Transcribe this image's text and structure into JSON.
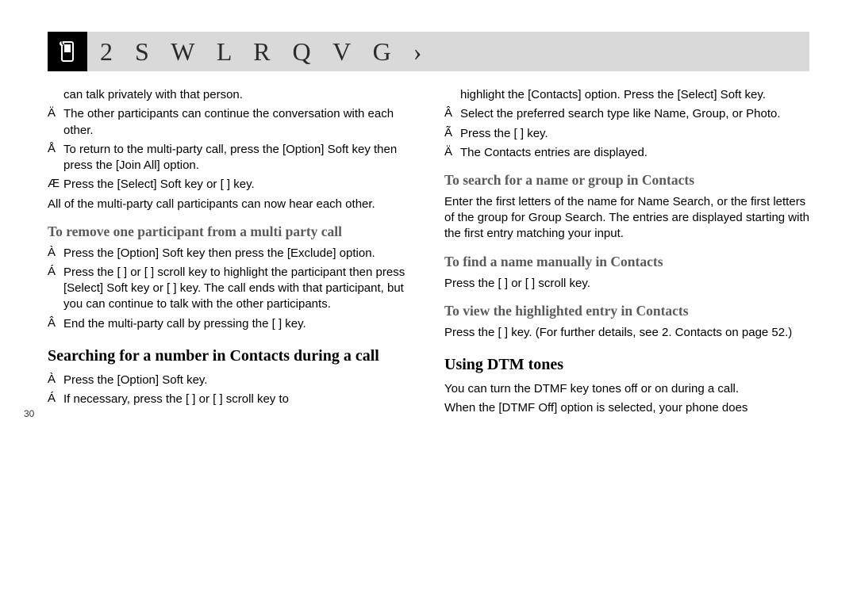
{
  "header": {
    "title": "2 S W L R Q V  G ›"
  },
  "page_number": "30",
  "left_col": {
    "p1": "can talk privately with that person.",
    "b1": "The other participants can continue the conversation with each other.",
    "b2": "To return to the multi-party call, press the [Option] Soft key then press the [Join All] option.",
    "b3": "Press the [Select] Soft key or [        ] key.",
    "p2": "All of the multi-party call participants can now hear each other.",
    "h1": "To remove one participant from a multi party   call",
    "b4": "Press the [Option] Soft key then press the [Exclude] option.",
    "b5": "Press the [        ] or [        ] scroll key to highlight the participant then press [Select] Soft key or [        ] key. The call ends with that participant, but you can continue to talk with the other participants.",
    "b6": "End the multi-party call by pressing the [          ] key.",
    "h2": "Searching for a number in Contacts during a call",
    "b7": "Press the [Option] Soft key.",
    "b8": "If necessary, press the [        ] or [        ] scroll key to"
  },
  "right_col": {
    "p1": "highlight the [Contacts] option. Press the [Select] Soft key.",
    "b1": "Select the preferred search type like Name, Group, or Photo.",
    "b2": "Press the [        ] key.",
    "b3": "The Contacts entries are displayed.",
    "h1": "To search for a name or group in Contacts",
    "p2": "Enter the first letters of the name for Name Search, or the first letters of the group for Group Search. The entries are displayed starting with the first entry matching your input.",
    "h2": "To find a name manually in Contacts",
    "p3": "Press the [        ] or [        ] scroll key.",
    "h3": "To view the highlighted entry in Contacts",
    "p4": "Press the [        ] key.  (For further details, see 2. Contacts on page 52.)",
    "h4": "Using DTM      tones",
    "p5": "You can turn the DTMF key tones off or on during a call.",
    "p6": "When the [DTMF Off] option is selected, your phone does"
  }
}
